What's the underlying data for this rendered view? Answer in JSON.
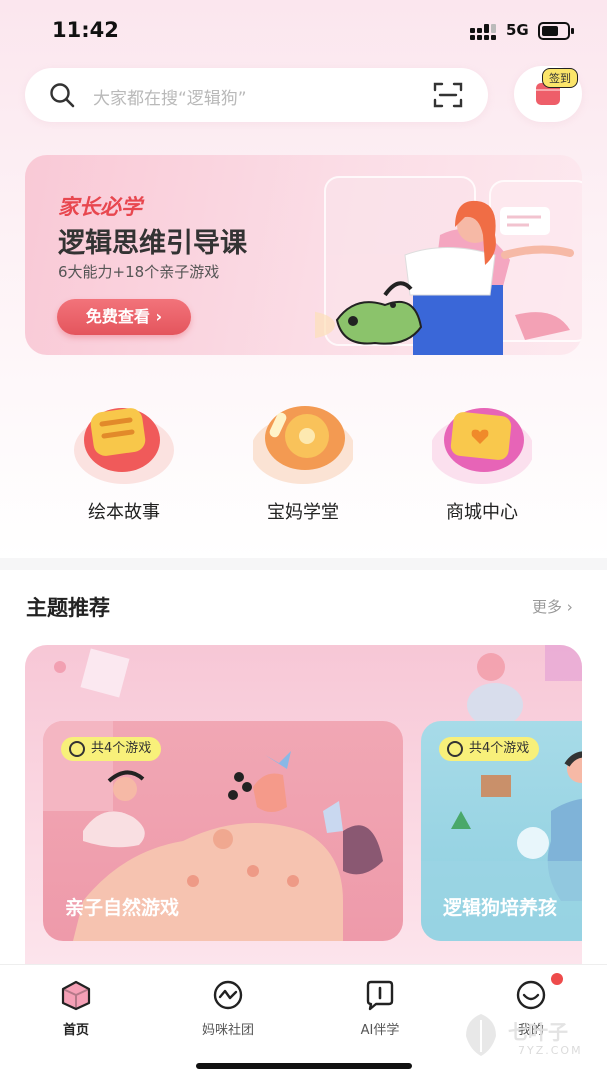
{
  "status_bar": {
    "time": "11:42",
    "network": "5G"
  },
  "search": {
    "placeholder": "大家都在搜“逻辑狗”"
  },
  "signin": {
    "label": "签到"
  },
  "banner": {
    "kicker": "家长必学",
    "title": "逻辑思维引导课",
    "subtitle": "6大能力+18个亲子游戏",
    "cta": "免费查看 ›"
  },
  "quick_entries": [
    {
      "label": "绘本故事",
      "icon": "book-icon"
    },
    {
      "label": "宝妈学堂",
      "icon": "disc-icon"
    },
    {
      "label": "商城中心",
      "icon": "shop-box-icon"
    }
  ],
  "themes": {
    "title": "主题推荐",
    "more": "更多 ›",
    "cards": [
      {
        "badge": "共4个游戏",
        "title": "亲子自然游戏"
      },
      {
        "badge": "共4个游戏",
        "title": "逻辑狗培养孩"
      }
    ]
  },
  "tabs": [
    {
      "label": "首页",
      "icon": "home-icon",
      "active": true
    },
    {
      "label": "妈咪社团",
      "icon": "community-icon",
      "active": false
    },
    {
      "label": "AI伴学",
      "icon": "ai-chat-icon",
      "active": false
    },
    {
      "label": "我的",
      "icon": "profile-icon",
      "active": false
    }
  ],
  "watermark": {
    "text": "七叶子",
    "sub": "7YZ.COM"
  },
  "colors": {
    "accent": "#e8474f",
    "badge_yellow": "#f8f07a",
    "banner_pink": "#f9c9d6",
    "game_pink": "#f1a7b4",
    "game_blue": "#a7dbe8"
  }
}
